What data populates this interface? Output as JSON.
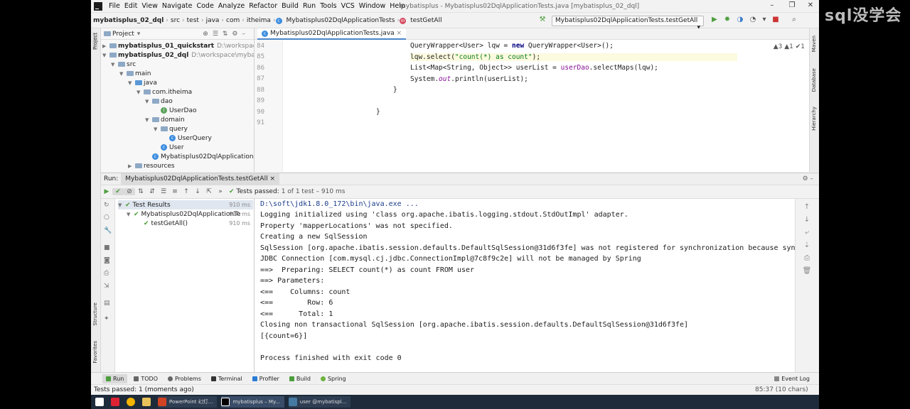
{
  "menu": [
    "File",
    "Edit",
    "View",
    "Navigate",
    "Code",
    "Analyze",
    "Refactor",
    "Build",
    "Run",
    "Tools",
    "VCS",
    "Window",
    "Help"
  ],
  "window_title": "mybatisplus - Mybatisplus02DqlApplicationTests.java [mybatisplus_02_dql]",
  "breadcrumbs": [
    "mybatisplus_02_dql",
    "src",
    "test",
    "java",
    "com",
    "itheima",
    "Mybatisplus02DqlApplicationTests",
    "testGetAll"
  ],
  "run_config": "Mybatisplus02DqlApplicationTests.testGetAll",
  "project": {
    "title": "Project",
    "tree": [
      {
        "label": "mybatisplus_01_quickstart",
        "path": "D:\\workspace\\m",
        "bold": true
      },
      {
        "label": "mybatisplus_02_dql",
        "path": "D:\\workspace\\mybatisp",
        "bold": true
      },
      {
        "label": "src"
      },
      {
        "label": "main"
      },
      {
        "label": "java"
      },
      {
        "label": "com.itheima"
      },
      {
        "label": "dao"
      },
      {
        "label": "UserDao"
      },
      {
        "label": "domain"
      },
      {
        "label": "query"
      },
      {
        "label": "UserQuery"
      },
      {
        "label": "User"
      },
      {
        "label": "Mybatisplus02DqlApplication"
      },
      {
        "label": "resources"
      }
    ]
  },
  "editor": {
    "tab": "Mybatisplus02DqlApplicationTests.java",
    "line_numbers": [
      "84",
      "85",
      "86",
      "87",
      "88",
      "89",
      "90",
      "91"
    ],
    "inspections": "▲3  ▲1  ✔1",
    "code": {
      "l84a": "QueryWrapper<User> lqw = ",
      "l84kw": "new",
      "l84b": " QueryWrapper<User>();",
      "l85a": "lqw.select(",
      "l85s": "\"count(*) as count\"",
      "l85b": ");",
      "l86a": "List<Map<String, Object>> userList = ",
      "l86v": "userDao",
      "l86b": ".selectMaps(lqw);",
      "l87a": "System.",
      "l87f": "out",
      "l87b": ".println(userList);",
      "l88": "}",
      "l90": "}"
    }
  },
  "run": {
    "label": "Run:",
    "tab": "Mybatisplus02DqlApplicationTests.testGetAll",
    "status_prefix": "Tests passed:",
    "status_value": "1 of 1 test – 910 ms",
    "results": [
      {
        "label": "Test Results",
        "ms": "910 ms"
      },
      {
        "label": "Mybatisplus02DqlApplicationTe",
        "ms": "910 ms"
      },
      {
        "label": "testGetAll()",
        "ms": "910 ms"
      }
    ],
    "console": [
      "D:\\soft\\jdk1.8.0_172\\bin\\java.exe ...",
      "Logging initialized using 'class org.apache.ibatis.logging.stdout.StdOutImpl' adapter.",
      "Property 'mapperLocations' was not specified.",
      "Creating a new SqlSession",
      "SqlSession [org.apache.ibatis.session.defaults.DefaultSqlSession@31d6f3fe] was not registered for synchronization because synchr",
      "JDBC Connection [com.mysql.cj.jdbc.ConnectionImpl@7c8f9c2e] will not be managed by Spring",
      "==>  Preparing: SELECT count(*) as count FROM user",
      "==> Parameters: ",
      "<==    Columns: count",
      "<==        Row: 6",
      "<==      Total: 1",
      "Closing non transactional SqlSession [org.apache.ibatis.session.defaults.DefaultSqlSession@31d6f3fe]",
      "[{count=6}]",
      "",
      "Process finished with exit code 0"
    ]
  },
  "bottom_tabs": [
    "Run",
    "TODO",
    "Problems",
    "Terminal",
    "Profiler",
    "Build",
    "Spring"
  ],
  "event_log": "Event Log",
  "status_text": "Tests passed: 1 (moments ago)",
  "cursor_pos": "85:37 (10 chars)",
  "side_labels": {
    "project": "Project",
    "structure": "Structure",
    "favorites": "Favorites",
    "maven": "Maven",
    "database": "Database",
    "hierarchy": "Hierarchy"
  },
  "taskbar": [
    "PowerPoint 幻灯...",
    "mybatisplus – My...",
    "user @mybatispl..."
  ],
  "watermark": "sql没学会"
}
